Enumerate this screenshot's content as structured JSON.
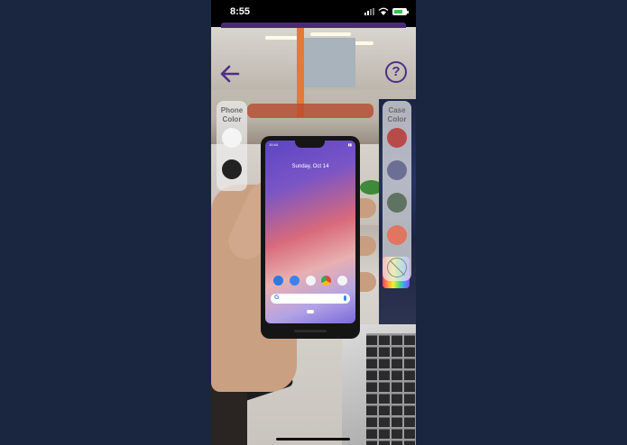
{
  "status_bar": {
    "time": "8:55"
  },
  "phone_panel": {
    "title_line1": "Phone",
    "title_line2": "Color",
    "swatches": [
      "#f4f4f4",
      "#222222"
    ]
  },
  "case_panel": {
    "title_line1": "Case",
    "title_line2": "Color",
    "swatches": [
      "#b84a4a",
      "#6b6f93",
      "#5e7361",
      "#e07560"
    ]
  },
  "device_screen": {
    "time": "10:44",
    "date": "Sunday, Oct 14",
    "search_logo": "G"
  },
  "icons": {
    "back": "arrow-left-icon",
    "help": "question-mark-icon",
    "no_case": "no-case-icon"
  },
  "help_button": {
    "label": "?"
  },
  "colors": {
    "accent": "#4d2e86",
    "background": "#1a2540"
  }
}
